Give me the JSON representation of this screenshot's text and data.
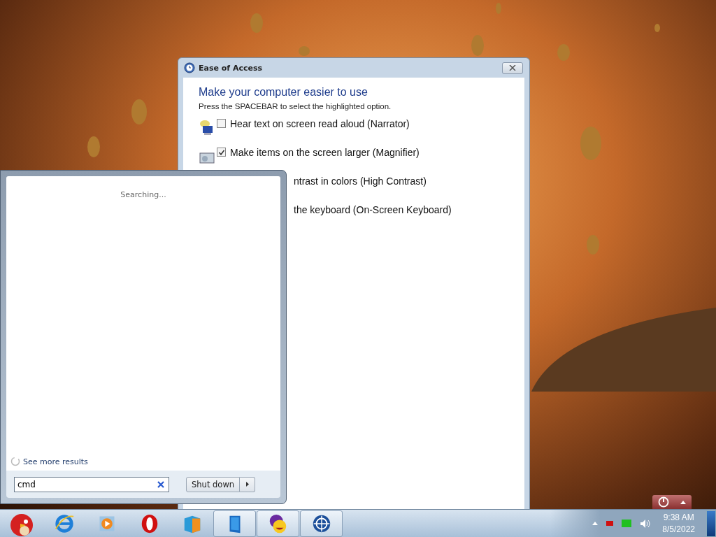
{
  "ease_window": {
    "title": "Ease of Access",
    "heading": "Make your computer easier to use",
    "instruction": "Press the SPACEBAR to select the highlighted option.",
    "options": [
      {
        "kind": "narrator",
        "label": "Hear text on screen read aloud (Narrator)",
        "checked": false
      },
      {
        "kind": "magnifier",
        "label": "Make items on the screen larger (Magnifier)",
        "checked": true
      },
      {
        "kind": "covered",
        "label": "ntrast in colors (High Contrast)"
      },
      {
        "kind": "covered",
        "label": "the keyboard (On-Screen Keyboard)"
      }
    ]
  },
  "start_menu": {
    "status": "Searching...",
    "more_results": "See more results",
    "search": {
      "value": "cmd"
    },
    "shutdown": "Shut down"
  },
  "taskbar": {
    "items": [
      {
        "kind": "bird",
        "running": false
      },
      {
        "kind": "browser",
        "running": false
      },
      {
        "kind": "media",
        "running": false
      },
      {
        "kind": "opera",
        "running": false
      },
      {
        "kind": "cube",
        "running": false
      },
      {
        "kind": "panel",
        "running": true
      },
      {
        "kind": "messenger",
        "running": true
      },
      {
        "kind": "wheel",
        "running": true
      }
    ],
    "tray": {
      "time": "9:38 AM",
      "date": "8/5/2022"
    }
  }
}
